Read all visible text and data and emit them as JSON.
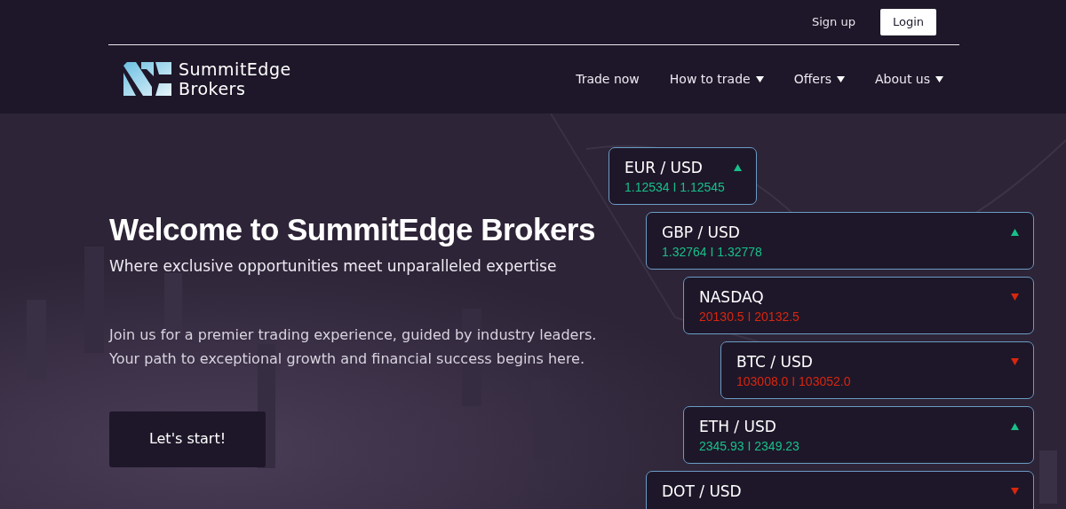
{
  "top_links": [
    {
      "label": "Sign up",
      "kind": "link"
    },
    {
      "label": "Login",
      "kind": "button"
    }
  ],
  "logo": {
    "line1": "SummitEdge",
    "line2": "Brokers"
  },
  "nav": [
    {
      "label": "Trade now",
      "dropdown": false
    },
    {
      "label": "How to trade",
      "dropdown": true
    },
    {
      "label": "Offers",
      "dropdown": true
    },
    {
      "label": "About us",
      "dropdown": true
    }
  ],
  "hero": {
    "title": "Welcome to SummitEdge Brokers",
    "subtitle": "Where exclusive opportunities meet unparalleled expertise",
    "body": [
      "Join us for a premier trading experience, guided by industry leaders.",
      "Your path to exceptional growth and financial success begins here."
    ],
    "button": "Let's start!"
  },
  "tickers": [
    {
      "symbol": "EUR / USD",
      "rising": true,
      "prices": "1.12534 I 1.12545"
    },
    {
      "symbol": "GBP / USD",
      "rising": true,
      "prices": "1.32764 I 1.32778"
    },
    {
      "symbol": "NASDAQ",
      "rising": false,
      "prices": "20130.5 I 20132.5"
    },
    {
      "symbol": "BTC / USD",
      "rising": false,
      "prices": "103008.0 I 103052.0"
    },
    {
      "symbol": "ETH / USD",
      "rising": true,
      "prices": "2345.93 I 2349.23"
    },
    {
      "symbol": "DOT / USD",
      "rising": false
    }
  ]
}
